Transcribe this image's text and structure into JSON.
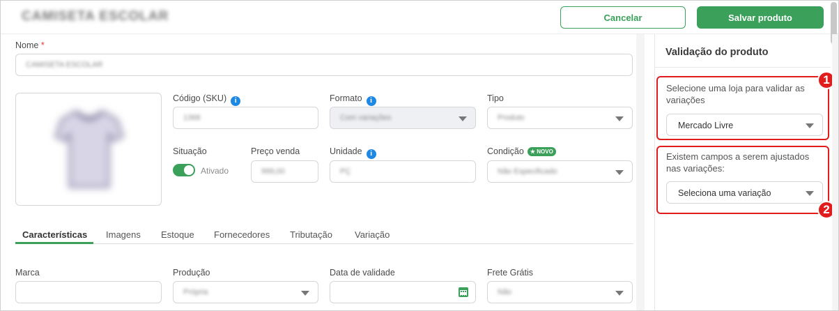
{
  "header": {
    "product_title": "CAMISETA ESCOLAR",
    "cancel_label": "Cancelar",
    "save_label": "Salvar produto"
  },
  "form": {
    "name": {
      "label": "Nome",
      "required_mark": "*",
      "value": "CAMISETA ESCOLAR"
    },
    "sku": {
      "label": "Código (SKU)",
      "value": "1368"
    },
    "formato": {
      "label": "Formato",
      "value": "Com variações"
    },
    "tipo": {
      "label": "Tipo",
      "value": "Produto"
    },
    "situacao": {
      "label": "Situação",
      "toggle_label": "Ativado",
      "enabled": true
    },
    "preco_venda": {
      "label": "Preço venda",
      "value": "999,00"
    },
    "unidade": {
      "label": "Unidade",
      "value": "PÇ"
    },
    "condicao": {
      "label": "Condição",
      "badge": "NOVO",
      "value": "Não Especificado"
    },
    "info_icon_glyph": "i"
  },
  "tabs": [
    {
      "label": "Características",
      "active": true
    },
    {
      "label": "Imagens",
      "active": false
    },
    {
      "label": "Estoque",
      "active": false
    },
    {
      "label": "Fornecedores",
      "active": false
    },
    {
      "label": "Tributação",
      "active": false
    },
    {
      "label": "Variação",
      "active": false
    }
  ],
  "characteristics": {
    "marca": {
      "label": "Marca",
      "value": ""
    },
    "producao": {
      "label": "Produção",
      "value": "Própria"
    },
    "data_validade": {
      "label": "Data de validade",
      "value": ""
    },
    "frete_gratis": {
      "label": "Frete Grátis",
      "value": "Não"
    }
  },
  "panel": {
    "title": "Validação do produto",
    "store_prompt": "Selecione uma loja para validar as variações",
    "store_value": "Mercado Livre",
    "variation_prompt": "Existem campos a serem ajustados nas variações:",
    "variation_value": "Seleciona uma variação",
    "badge_1": "1",
    "badge_2": "2"
  },
  "colors": {
    "primary_green": "#3aa05a",
    "highlight_red": "#e01c1c",
    "info_blue": "#1e88e5"
  },
  "icons": {
    "info": "info-icon",
    "dropdown": "chevron-down-icon",
    "calendar": "calendar-icon",
    "product_image": "tshirt-image"
  }
}
